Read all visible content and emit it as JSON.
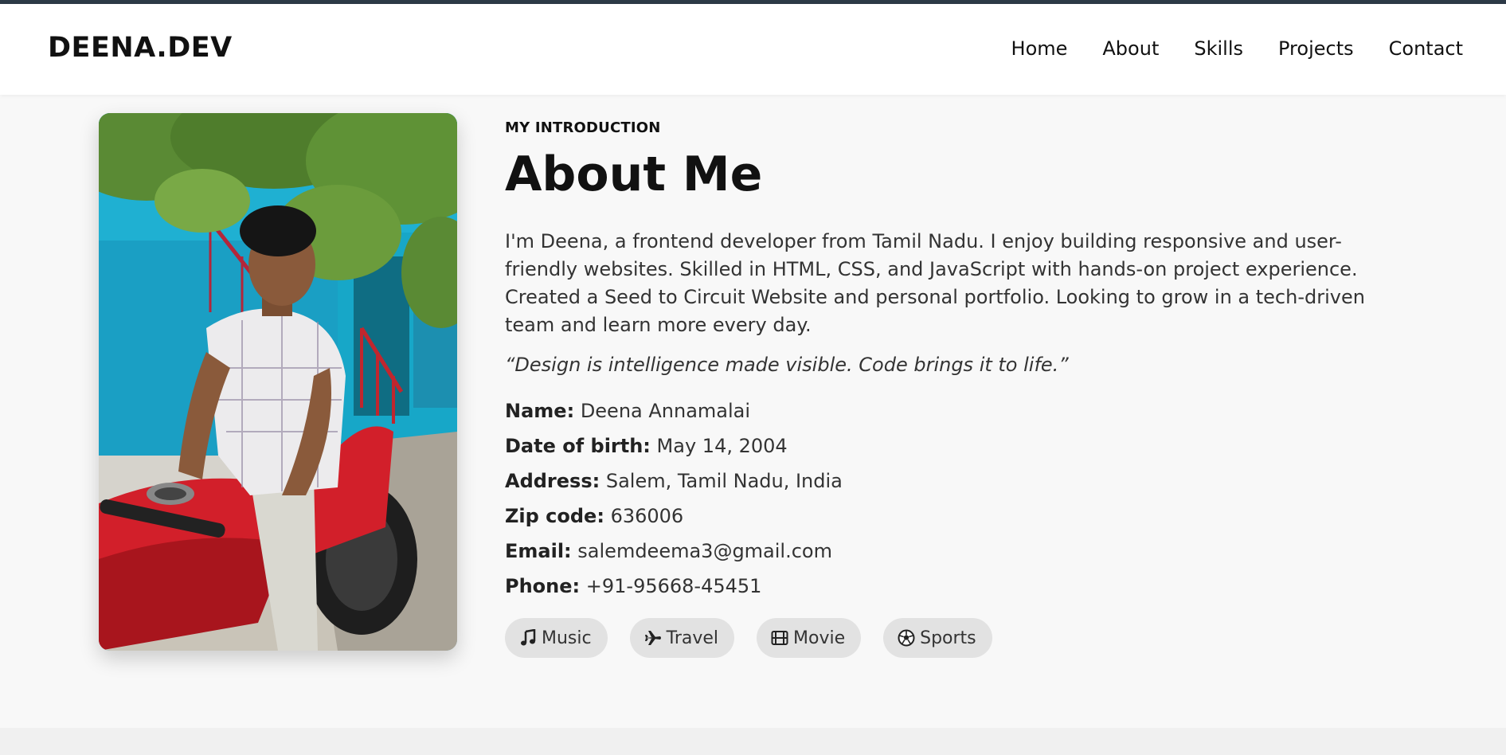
{
  "brand": {
    "logo": "DEENA.DEV"
  },
  "nav": {
    "items": [
      "Home",
      "About",
      "Skills",
      "Projects",
      "Contact"
    ]
  },
  "about": {
    "eyebrow": "MY INTRODUCTION",
    "title": "About Me",
    "intro": "I'm Deena, a frontend developer from Tamil Nadu. I enjoy building responsive and user-friendly websites. Skilled in HTML, CSS, and JavaScript with hands-on project experience. Created a Seed to Circuit Website and personal portfolio. Looking to grow in a tech-driven team and learn more every day.",
    "quote": "“Design is intelligence made visible. Code brings it to life.”",
    "details": [
      {
        "label": "Name:",
        "value": "Deena Annamalai"
      },
      {
        "label": "Date of birth:",
        "value": "May 14, 2004"
      },
      {
        "label": "Address:",
        "value": "Salem, Tamil Nadu, India"
      },
      {
        "label": "Zip code:",
        "value": "636006"
      },
      {
        "label": "Email:",
        "value": "salemdeema3@gmail.com"
      },
      {
        "label": "Phone:",
        "value": "+91-95668-45451"
      }
    ],
    "interests": [
      {
        "label": "Music",
        "icon": "music-icon"
      },
      {
        "label": "Travel",
        "icon": "plane-icon"
      },
      {
        "label": "Movie",
        "icon": "film-icon"
      },
      {
        "label": "Sports",
        "icon": "soccer-ball-icon"
      }
    ]
  },
  "colors": {
    "top_strip": "#2d3a47",
    "page_bg": "#f8f8f8",
    "chip_bg": "#e2e2e2"
  }
}
